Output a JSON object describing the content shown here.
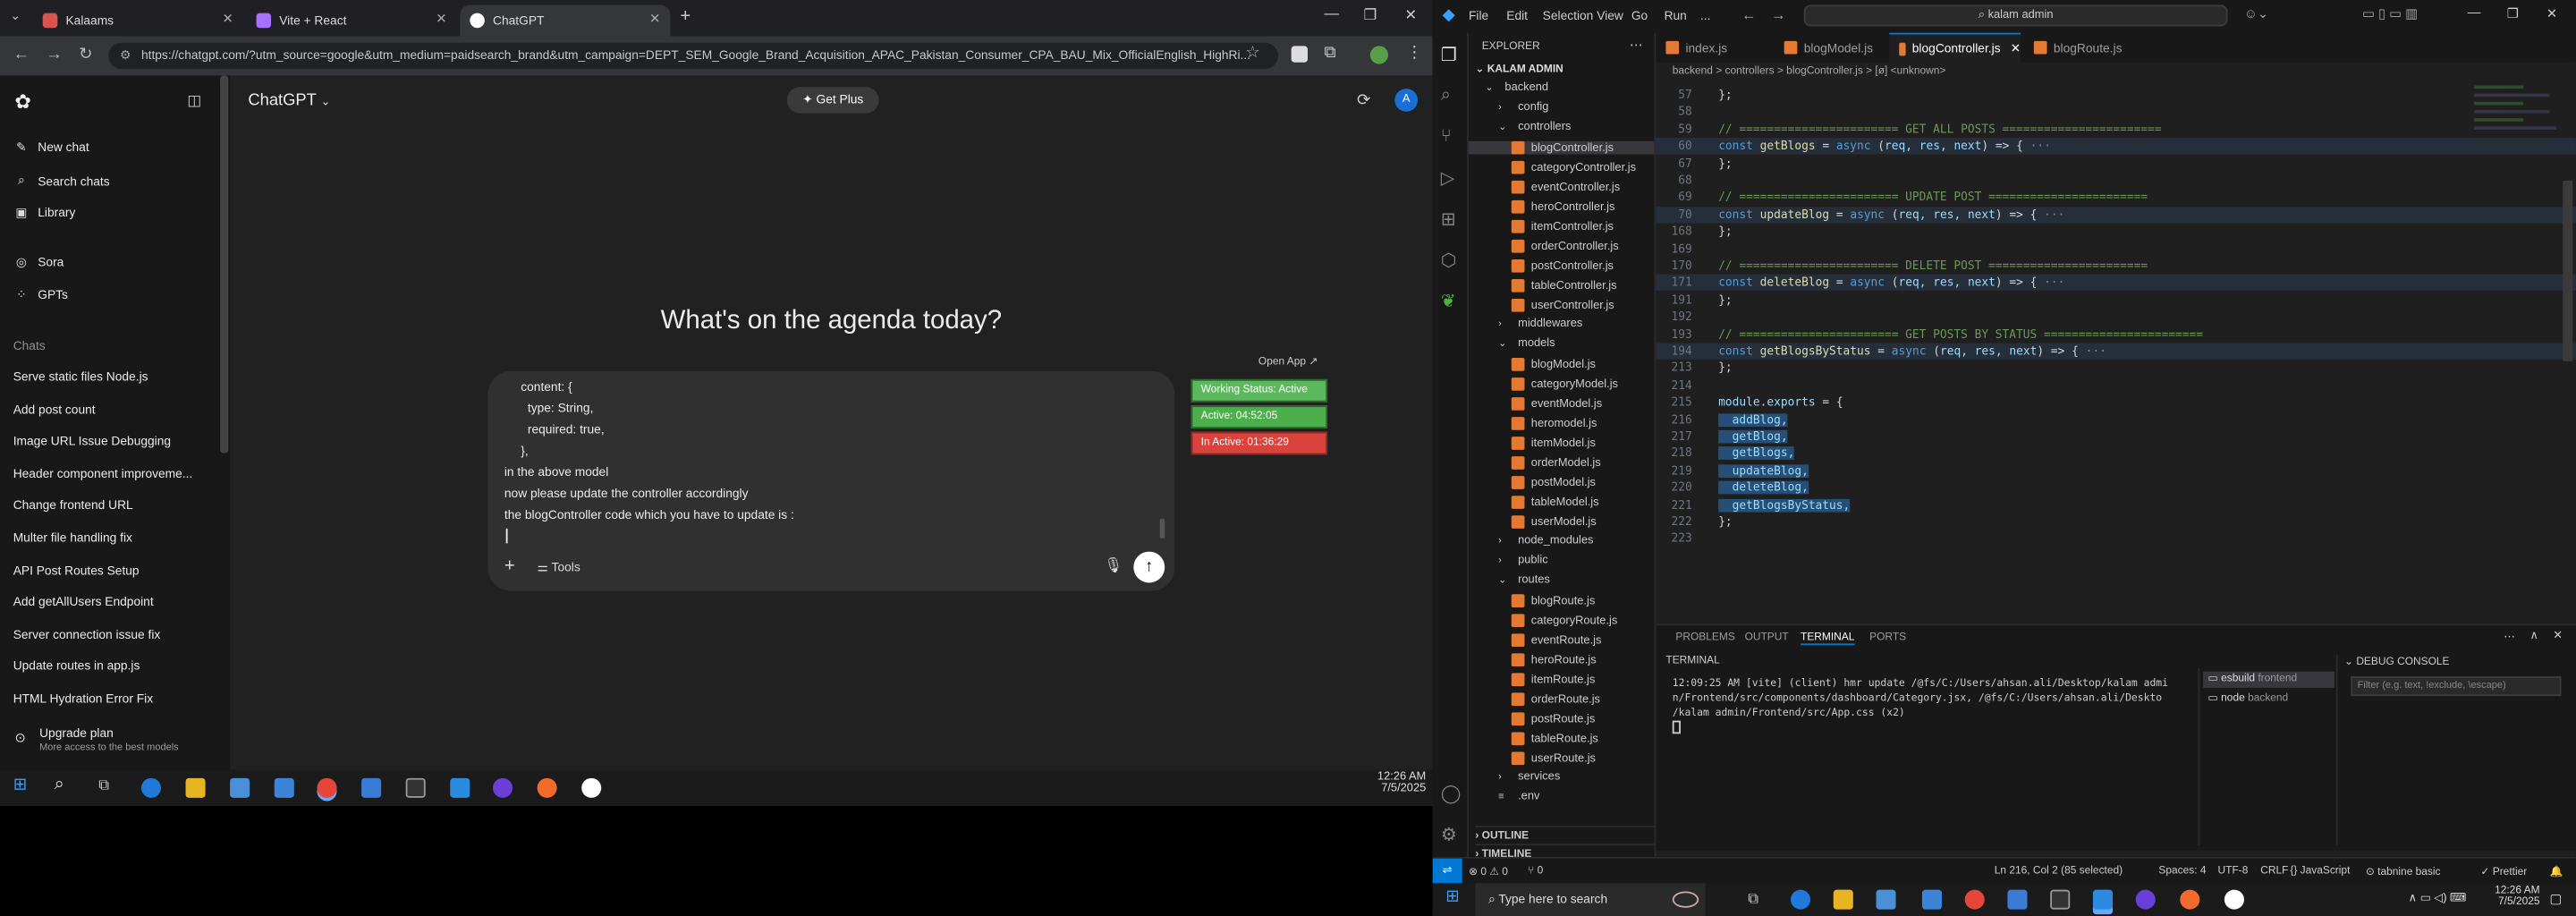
{
  "browser": {
    "tabs": [
      {
        "title": "Kalaams",
        "color": "#d9534f"
      },
      {
        "title": "Vite + React",
        "color": "#a970ff"
      },
      {
        "title": "ChatGPT",
        "color": "#ffffff"
      }
    ],
    "url": "https://chatgpt.com/?utm_source=google&utm_medium=paidsearch_brand&utm_campaign=DEPT_SEM_Google_Brand_Acquisition_APAC_Pakistan_Consumer_CPA_BAU_Mix_OfficialEnglish_HighRi..."
  },
  "chatgpt": {
    "sidebar": {
      "new_chat": "New chat",
      "search_chats": "Search chats",
      "library": "Library",
      "sora": "Sora",
      "gpts": "GPTs",
      "chats_heading": "Chats",
      "chats": [
        "Serve static files Node.js",
        "Add post count",
        "Image URL Issue Debugging",
        "Header component improveme...",
        "Change frontend URL",
        "Multer file handling fix",
        "API Post Routes Setup",
        "Add getAllUsers Endpoint",
        "Server connection issue fix",
        "Update routes in app.js",
        "HTML Hydration Error Fix"
      ],
      "upgrade_title": "Upgrade plan",
      "upgrade_sub": "More access to the best models"
    },
    "header": {
      "model": "ChatGPT",
      "get_plus": "Get Plus",
      "avatar": "A"
    },
    "heading": "What's on the agenda today?",
    "composer": {
      "lines": [
        "content: {",
        "  type: String,",
        "  required: true,",
        "},",
        "in the above model",
        "now please update the controller accordingly",
        "the blogController code which you have to update is :"
      ],
      "tools": "Tools"
    },
    "widget": {
      "open_app": "Open App",
      "working_status": "Working Status: Active",
      "active": "Active: 04:52:05",
      "inactive": "In Active: 01:36:29"
    }
  },
  "clock": {
    "time": "12:26 AM",
    "date": "7/5/2025"
  },
  "vscode": {
    "menu": [
      "File",
      "Edit",
      "Selection",
      "View",
      "Go",
      "Run",
      "..."
    ],
    "search": "kalam admin",
    "explorer": {
      "title": "EXPLORER",
      "root": "KALAM ADMIN",
      "items": [
        {
          "label": "backend",
          "type": "folder",
          "indent": 0,
          "open": true
        },
        {
          "label": "config",
          "type": "folder",
          "indent": 1,
          "open": false
        },
        {
          "label": "controllers",
          "type": "folder",
          "indent": 1,
          "open": true
        },
        {
          "label": "blogController.js",
          "type": "js",
          "indent": 2,
          "selected": true
        },
        {
          "label": "categoryController.js",
          "type": "js",
          "indent": 2
        },
        {
          "label": "eventController.js",
          "type": "js",
          "indent": 2
        },
        {
          "label": "heroController.js",
          "type": "js",
          "indent": 2
        },
        {
          "label": "itemController.js",
          "type": "js",
          "indent": 2
        },
        {
          "label": "orderController.js",
          "type": "js",
          "indent": 2
        },
        {
          "label": "postController.js",
          "type": "js",
          "indent": 2
        },
        {
          "label": "tableController.js",
          "type": "js",
          "indent": 2
        },
        {
          "label": "userController.js",
          "type": "js",
          "indent": 2
        },
        {
          "label": "middlewares",
          "type": "folder",
          "indent": 1,
          "open": false
        },
        {
          "label": "models",
          "type": "folder",
          "indent": 1,
          "open": true
        },
        {
          "label": "blogModel.js",
          "type": "js",
          "indent": 2
        },
        {
          "label": "categoryModel.js",
          "type": "js",
          "indent": 2
        },
        {
          "label": "eventModel.js",
          "type": "js",
          "indent": 2
        },
        {
          "label": "heromodel.js",
          "type": "js",
          "indent": 2
        },
        {
          "label": "itemModel.js",
          "type": "js",
          "indent": 2
        },
        {
          "label": "orderModel.js",
          "type": "js",
          "indent": 2
        },
        {
          "label": "postModel.js",
          "type": "js",
          "indent": 2
        },
        {
          "label": "tableModel.js",
          "type": "js",
          "indent": 2
        },
        {
          "label": "userModel.js",
          "type": "js",
          "indent": 2
        },
        {
          "label": "node_modules",
          "type": "folder",
          "indent": 1,
          "open": false
        },
        {
          "label": "public",
          "type": "folder",
          "indent": 1,
          "open": false
        },
        {
          "label": "routes",
          "type": "folder",
          "indent": 1,
          "open": true
        },
        {
          "label": "blogRoute.js",
          "type": "js",
          "indent": 2
        },
        {
          "label": "categoryRoute.js",
          "type": "js",
          "indent": 2
        },
        {
          "label": "eventRoute.js",
          "type": "js",
          "indent": 2
        },
        {
          "label": "heroRoute.js",
          "type": "js",
          "indent": 2
        },
        {
          "label": "itemRoute.js",
          "type": "js",
          "indent": 2
        },
        {
          "label": "orderRoute.js",
          "type": "js",
          "indent": 2
        },
        {
          "label": "postRoute.js",
          "type": "js",
          "indent": 2
        },
        {
          "label": "tableRoute.js",
          "type": "js",
          "indent": 2
        },
        {
          "label": "userRoute.js",
          "type": "js",
          "indent": 2
        },
        {
          "label": "services",
          "type": "folder",
          "indent": 1,
          "open": false
        },
        {
          "label": ".env",
          "type": "file",
          "indent": 1
        }
      ],
      "outline": "OUTLINE",
      "timeline": "TIMELINE"
    },
    "tabs": [
      "index.js",
      "blogModel.js",
      "blogController.js",
      "blogRoute.js"
    ],
    "breadcrumb": "backend > controllers > blogController.js > [ø] <unknown>",
    "code": [
      {
        "n": "57",
        "t": [
          [
            "};",
            "pu"
          ]
        ]
      },
      {
        "n": "58",
        "t": []
      },
      {
        "n": "59",
        "t": [
          [
            "// ======================= GET ALL POSTS =======================",
            "cm"
          ]
        ]
      },
      {
        "n": "60",
        "t": [
          [
            "const ",
            "kw"
          ],
          [
            "getBlogs",
            "fn"
          ],
          [
            " = ",
            "pu"
          ],
          [
            "async ",
            "kw"
          ],
          [
            "(",
            "pu"
          ],
          [
            "req, res, next",
            "va"
          ],
          [
            ") => { ",
            "pu"
          ],
          [
            "···",
            "fo"
          ]
        ],
        "fold": true
      },
      {
        "n": "67",
        "t": [
          [
            "};",
            "pu"
          ]
        ]
      },
      {
        "n": "68",
        "t": []
      },
      {
        "n": "69",
        "t": [
          [
            "// ======================= UPDATE POST =======================",
            "cm"
          ]
        ]
      },
      {
        "n": "70",
        "t": [
          [
            "const ",
            "kw"
          ],
          [
            "updateBlog",
            "fn"
          ],
          [
            " = ",
            "pu"
          ],
          [
            "async ",
            "kw"
          ],
          [
            "(",
            "pu"
          ],
          [
            "req, res, next",
            "va"
          ],
          [
            ") => { ",
            "pu"
          ],
          [
            "···",
            "fo"
          ]
        ],
        "fold": true
      },
      {
        "n": "168",
        "t": [
          [
            "};",
            "pu"
          ]
        ]
      },
      {
        "n": "169",
        "t": []
      },
      {
        "n": "170",
        "t": [
          [
            "// ======================= DELETE POST =======================",
            "cm"
          ]
        ]
      },
      {
        "n": "171",
        "t": [
          [
            "const ",
            "kw"
          ],
          [
            "deleteBlog",
            "fn"
          ],
          [
            " = ",
            "pu"
          ],
          [
            "async ",
            "kw"
          ],
          [
            "(",
            "pu"
          ],
          [
            "req, res, next",
            "va"
          ],
          [
            ") => { ",
            "pu"
          ],
          [
            "···",
            "fo"
          ]
        ],
        "fold": true
      },
      {
        "n": "191",
        "t": [
          [
            "};",
            "pu"
          ]
        ]
      },
      {
        "n": "192",
        "t": []
      },
      {
        "n": "193",
        "t": [
          [
            "// ======================= GET POSTS BY STATUS =======================",
            "cm"
          ]
        ]
      },
      {
        "n": "194",
        "t": [
          [
            "const ",
            "kw"
          ],
          [
            "getBlogsByStatus",
            "fn"
          ],
          [
            " = ",
            "pu"
          ],
          [
            "async ",
            "kw"
          ],
          [
            "(",
            "pu"
          ],
          [
            "req, res, next",
            "va"
          ],
          [
            ") => { ",
            "pu"
          ],
          [
            "···",
            "fo"
          ]
        ],
        "fold": true
      },
      {
        "n": "213",
        "t": [
          [
            "};",
            "pu"
          ]
        ]
      },
      {
        "n": "214",
        "t": []
      },
      {
        "n": "215",
        "t": [
          [
            "module",
            "va"
          ],
          [
            ".",
            "pu"
          ],
          [
            "exports",
            "va"
          ],
          [
            " = {",
            "pu"
          ]
        ]
      },
      {
        "n": "216",
        "t": [
          [
            "  addBlog,",
            "va"
          ]
        ],
        "sel": true
      },
      {
        "n": "217",
        "t": [
          [
            "  getBlog,",
            "va"
          ]
        ],
        "sel": true
      },
      {
        "n": "218",
        "t": [
          [
            "  getBlogs,",
            "va"
          ]
        ],
        "sel": true
      },
      {
        "n": "219",
        "t": [
          [
            "  updateBlog,",
            "va"
          ]
        ],
        "sel": true
      },
      {
        "n": "220",
        "t": [
          [
            "  deleteBlog,",
            "va"
          ]
        ],
        "sel": true
      },
      {
        "n": "221",
        "t": [
          [
            "  getBlogsByStatus,",
            "va"
          ]
        ],
        "sel": true
      },
      {
        "n": "222",
        "t": [
          [
            "};",
            "pu"
          ]
        ]
      },
      {
        "n": "223",
        "t": []
      }
    ],
    "panel": {
      "tabs": [
        "PROBLEMS",
        "OUTPUT",
        "TERMINAL",
        "PORTS"
      ],
      "terminal_title": "TERMINAL",
      "terminal_lines": [
        "12:09:25 AM [vite] (client) hmr update /@fs/C:/Users/ahsan.ali/Desktop/kalam admi",
        "n/Frontend/src/components/dashboard/Category.jsx, /@fs/C:/Users/ahsan.ali/Deskto",
        "/kalam admin/Frontend/src/App.css (x2)"
      ],
      "terminals": [
        {
          "name": "esbuild",
          "tag": "frontend"
        },
        {
          "name": "node",
          "tag": "backend"
        }
      ],
      "debug_title": "DEBUG CONSOLE",
      "debug_filter": "Filter (e.g. text, !exclude, \\escape)"
    },
    "status": {
      "errors": "⊗ 0  ⚠ 0",
      "ports": "⑂ 0",
      "position": "Ln 216, Col 2 (85 selected)",
      "spaces": "Spaces: 4",
      "encoding": "UTF-8",
      "eol": "CRLF",
      "lang": "{} JavaScript",
      "tabnine": "⊙ tabnine basic",
      "prettier": "✓ Prettier"
    }
  },
  "taskbar": {
    "search": "Type here to search",
    "time": "12:26 AM",
    "date": "7/5/2025"
  }
}
